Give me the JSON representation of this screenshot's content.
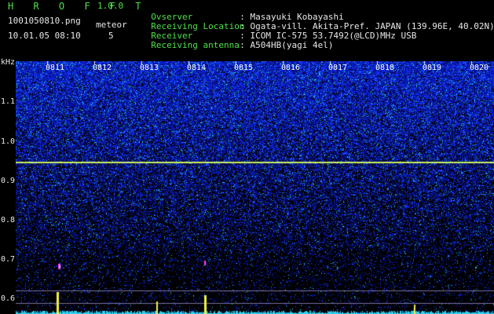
{
  "header": {
    "brand": "H R O F F T",
    "version": "1.0.0",
    "filename": "1001050810.png",
    "meteor_label": "meteor",
    "datetime": "10.01.05 08:10",
    "meteor_count": "5"
  },
  "info": [
    {
      "label": "Ovserver",
      "sep": ":",
      "value": "Masayuki Kobayashi"
    },
    {
      "label": "Receiving Location",
      "sep": ":",
      "value": "Ogata-vill. Akita-Pref. JAPAN (139.96E, 40.02N)"
    },
    {
      "label": "Receiver",
      "sep": ":",
      "value": "ICOM IC-575 53.7492(@LCD)MHz USB"
    },
    {
      "label": "Receiving antenna",
      "sep": ":",
      "value": "A504HB(yagi 4el)"
    }
  ],
  "spectrogram": {
    "unit_label": "kHz",
    "y_ticks": [
      "1.1",
      "1.0",
      "0.9",
      "0.8",
      "0.7",
      "0.6"
    ],
    "time_labels": [
      "0811",
      "0812",
      "0813",
      "0814",
      "0815",
      "0816",
      "0817",
      "0818",
      "0819",
      "0820"
    ],
    "carrier_freq_khz": 0.95,
    "meteor_echoes_minute": [
      "0811",
      "0814"
    ],
    "colors": {
      "carrier": "#c8f060",
      "background": "#000000",
      "noise_high": "#1e3cff",
      "echo": "#ff40ff"
    }
  }
}
